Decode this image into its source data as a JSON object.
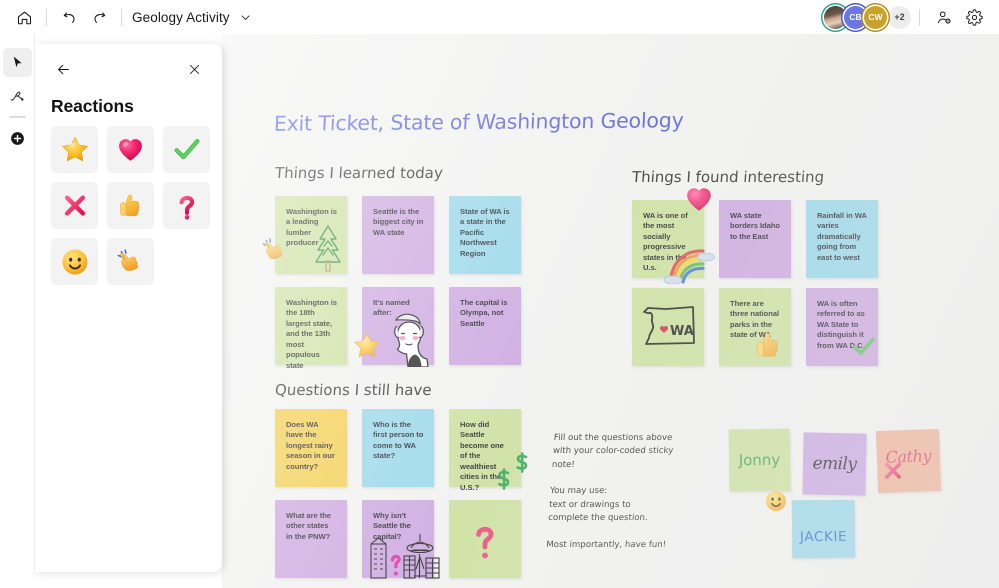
{
  "topbar": {
    "home_icon": "home-icon",
    "undo_icon": "undo-icon",
    "redo_icon": "redo-icon",
    "title": "Geology Activity",
    "title_chevron_icon": "chevron-down-icon",
    "avatars": [
      {
        "name": "avatar-photo",
        "initials": "",
        "ring": "#19a38a",
        "bg": ""
      },
      {
        "name": "avatar-cb",
        "initials": "CB",
        "ring": "#3f51d6",
        "bg": "#6a77e0"
      },
      {
        "name": "avatar-cw",
        "initials": "CW",
        "ring": "#b08a10",
        "bg": "#c9a227"
      }
    ],
    "overflow_label": "+2",
    "share_icon": "add-person-icon",
    "settings_icon": "gear-icon"
  },
  "rail": {
    "items": [
      {
        "name": "select-tool",
        "icon": "cursor-arrow-icon",
        "active": true
      },
      {
        "name": "pen-tool",
        "icon": "pen-icon",
        "active": false
      },
      {
        "name": "add-tool",
        "icon": "plus-circle-icon",
        "active": false
      }
    ]
  },
  "panel": {
    "back_icon": "back-arrow-icon",
    "close_icon": "close-icon",
    "title": "Reactions",
    "reactions": [
      {
        "name": "reaction-star",
        "icon": "star-emoji"
      },
      {
        "name": "reaction-heart",
        "icon": "heart-emoji"
      },
      {
        "name": "reaction-check",
        "icon": "check-mark-emoji"
      },
      {
        "name": "reaction-cross",
        "icon": "cross-mark-emoji"
      },
      {
        "name": "reaction-thumbs-up",
        "icon": "thumbs-up-emoji"
      },
      {
        "name": "reaction-question",
        "icon": "question-mark-emoji"
      },
      {
        "name": "reaction-smile",
        "icon": "smiley-emoji"
      },
      {
        "name": "reaction-clap",
        "icon": "clapping-hands-emoji"
      }
    ]
  },
  "board": {
    "title": "Exit Ticket, State of Washington Geology",
    "sections": [
      {
        "id": "learned",
        "heading": "Things I learned today"
      },
      {
        "id": "interesting",
        "heading": "Things I found interesting"
      },
      {
        "id": "questions",
        "heading": "Questions I still have"
      }
    ],
    "instructions": "Fill out the questions above\nwith your color-coded sticky\nnote!\n\nYou may use:\ntext or drawings to\ncomplete the question.\n\nMost importantly, have fun!",
    "colors": {
      "green": "#c8de96",
      "purple": "#c89fdd",
      "blue": "#8ed4e8",
      "yellow": "#f3ca3e",
      "peach": "#f0a98b",
      "lavender": "#c49fe0"
    },
    "notes_learned": [
      {
        "text": "Washington is a leading lumber producer",
        "color": "#c8de96",
        "art": "pine-tree-drawing"
      },
      {
        "text": "Seattle is the biggest city in WA state",
        "color": "#c89fdd",
        "art": ""
      },
      {
        "text": "State of WA is a state in the Pacific Northwest Region",
        "color": "#8ed4e8",
        "art": ""
      },
      {
        "text": "Washington is the 18th largest state, and the 13th most populous state",
        "color": "#c8de96",
        "art": ""
      },
      {
        "text": "It's named after:",
        "color": "#c89fdd",
        "art": "george-washington-drawing"
      },
      {
        "text": "The capital is Olympa, not Seattle",
        "color": "#c89fdd",
        "art": ""
      }
    ],
    "notes_interesting": [
      {
        "text": "WA is one of the most socially progressive states in the U.s.",
        "color": "#c8de96",
        "art": "rainbow-drawing"
      },
      {
        "text": "WA state borders Idaho to the East",
        "color": "#c89fdd",
        "art": ""
      },
      {
        "text": "Rainfall in WA varies dramatically going from east to west",
        "color": "#8ed4e8",
        "art": ""
      },
      {
        "text": "",
        "color": "#c8de96",
        "art": "washington-state-map-drawing",
        "art_label": "WA"
      },
      {
        "text": "There are three national parks in the state of WA",
        "color": "#c8de96",
        "art": ""
      },
      {
        "text": "WA is often referred to as WA State to distinguish it from WA D.C.",
        "color": "#c89fdd",
        "art": ""
      }
    ],
    "notes_questions": [
      {
        "text": "Does WA have the longest rainy season in our country?",
        "color": "#f3ca3e",
        "art": ""
      },
      {
        "text": "Who is the first person to come to WA state?",
        "color": "#8ed4e8",
        "art": ""
      },
      {
        "text": "How did Seattle become one of the wealthiest cities in the U.S.?",
        "color": "#c8de96",
        "art": "dollar-signs-drawing"
      },
      {
        "text": "What are the other states in the PNW?",
        "color": "#c89fdd",
        "art": ""
      },
      {
        "text": "Why isn't Seattle the capital?",
        "color": "#c89fdd",
        "art": "seattle-skyline-drawing"
      },
      {
        "text": "",
        "color": "#c8de96",
        "art": "question-mark-drawing"
      }
    ],
    "name_notes": [
      {
        "name": "Jonny",
        "color": "#c8de96",
        "ink": "#2f9e44"
      },
      {
        "name": "emily",
        "color": "#c49fe0",
        "ink": "#111111"
      },
      {
        "name": "Cathy",
        "color": "#f0a98b",
        "ink": "#e0285a"
      },
      {
        "name": "JACKIE",
        "color": "#8ed4e8",
        "ink": "#2257c7"
      }
    ],
    "canvas_emojis": [
      {
        "name": "clap-sticker",
        "icon": "clapping-hands-emoji"
      },
      {
        "name": "star-sticker",
        "icon": "star-emoji"
      },
      {
        "name": "heart-sticker",
        "icon": "heart-emoji"
      },
      {
        "name": "thumbs-up-sticker",
        "icon": "thumbs-up-emoji"
      },
      {
        "name": "check-sticker",
        "icon": "check-mark-emoji"
      },
      {
        "name": "smile-sticker",
        "icon": "smiley-emoji"
      },
      {
        "name": "cross-sticker",
        "icon": "cross-mark-emoji"
      }
    ]
  }
}
